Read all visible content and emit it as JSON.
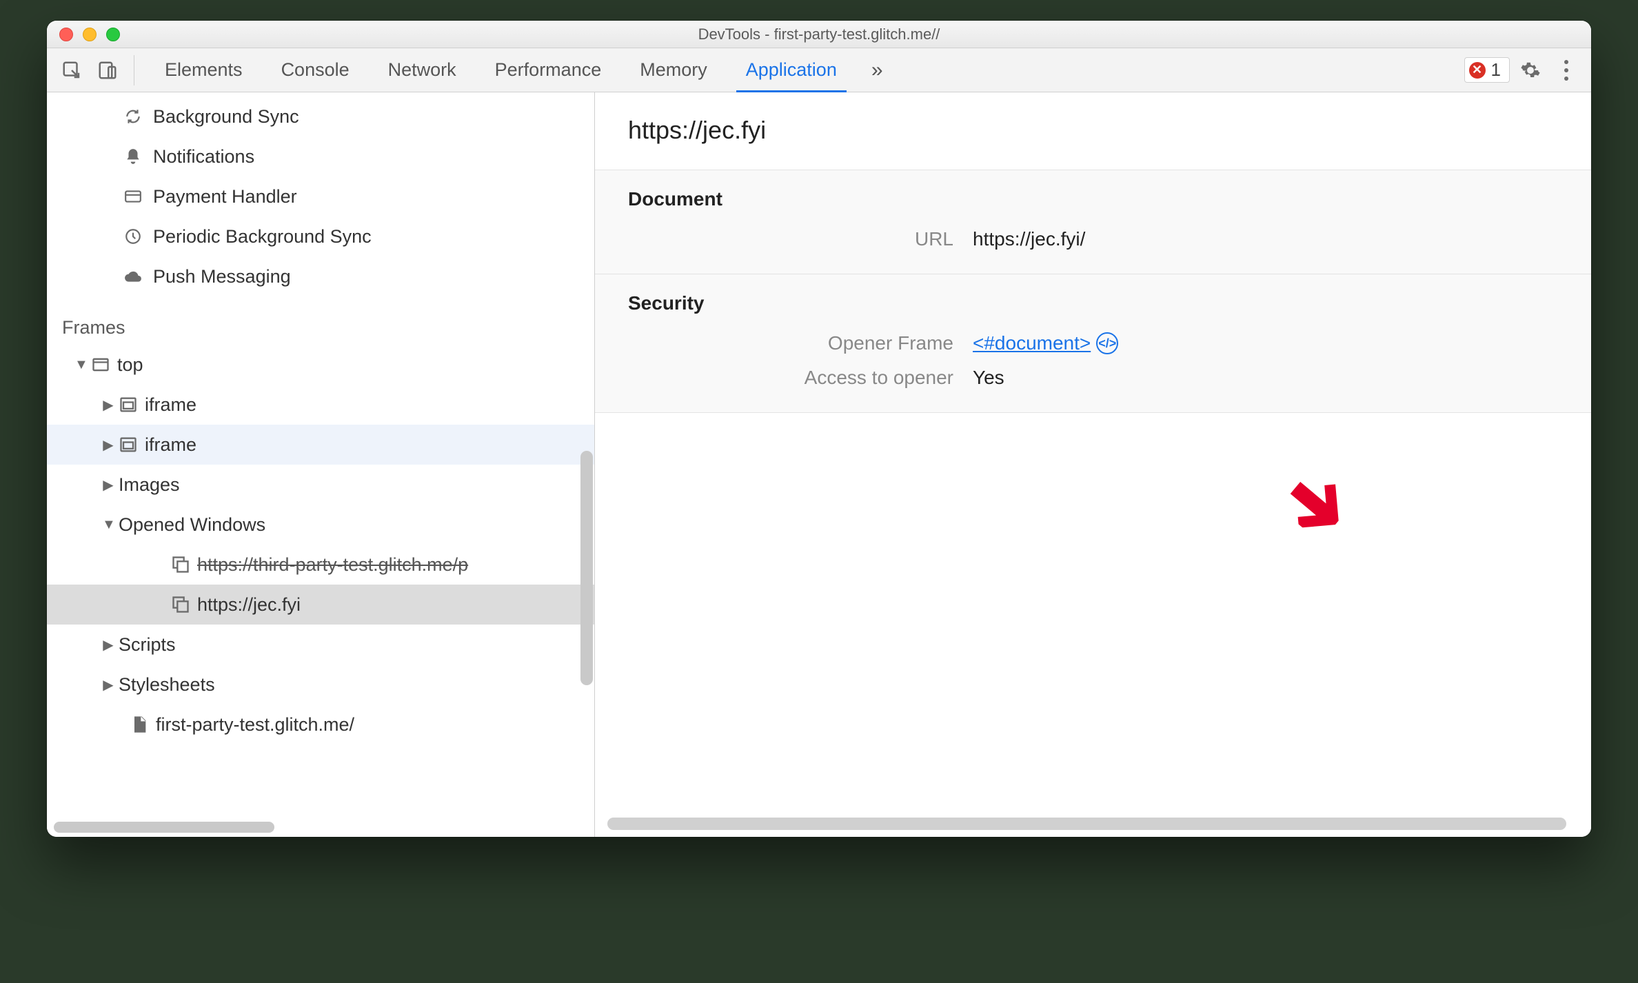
{
  "window": {
    "title": "DevTools - first-party-test.glitch.me//"
  },
  "toolbar": {
    "tabs": [
      "Elements",
      "Console",
      "Network",
      "Performance",
      "Memory",
      "Application"
    ],
    "active_tab": "Application",
    "more_tabs_glyph": "»",
    "error_count": "1"
  },
  "sidebar": {
    "bg_items": [
      {
        "label": "Background Sync",
        "icon": "sync"
      },
      {
        "label": "Notifications",
        "icon": "bell"
      },
      {
        "label": "Payment Handler",
        "icon": "card"
      },
      {
        "label": "Periodic Background Sync",
        "icon": "clock"
      },
      {
        "label": "Push Messaging",
        "icon": "cloud"
      }
    ],
    "frames_header": "Frames",
    "tree": {
      "top": "top",
      "iframe1": "iframe",
      "iframe2": "iframe",
      "images": "Images",
      "opened": "Opened Windows",
      "win1": "https://third-party-test.glitch.me/p",
      "win2": "https://jec.fyi",
      "scripts": "Scripts",
      "stylesheets": "Stylesheets",
      "doc": "first-party-test.glitch.me/"
    }
  },
  "main": {
    "title": "https://jec.fyi",
    "document_section": "Document",
    "url_label": "URL",
    "url_value": "https://jec.fyi/",
    "security_section": "Security",
    "opener_label": "Opener Frame",
    "opener_link": "<#document>",
    "access_label": "Access to opener",
    "access_value": "Yes"
  }
}
